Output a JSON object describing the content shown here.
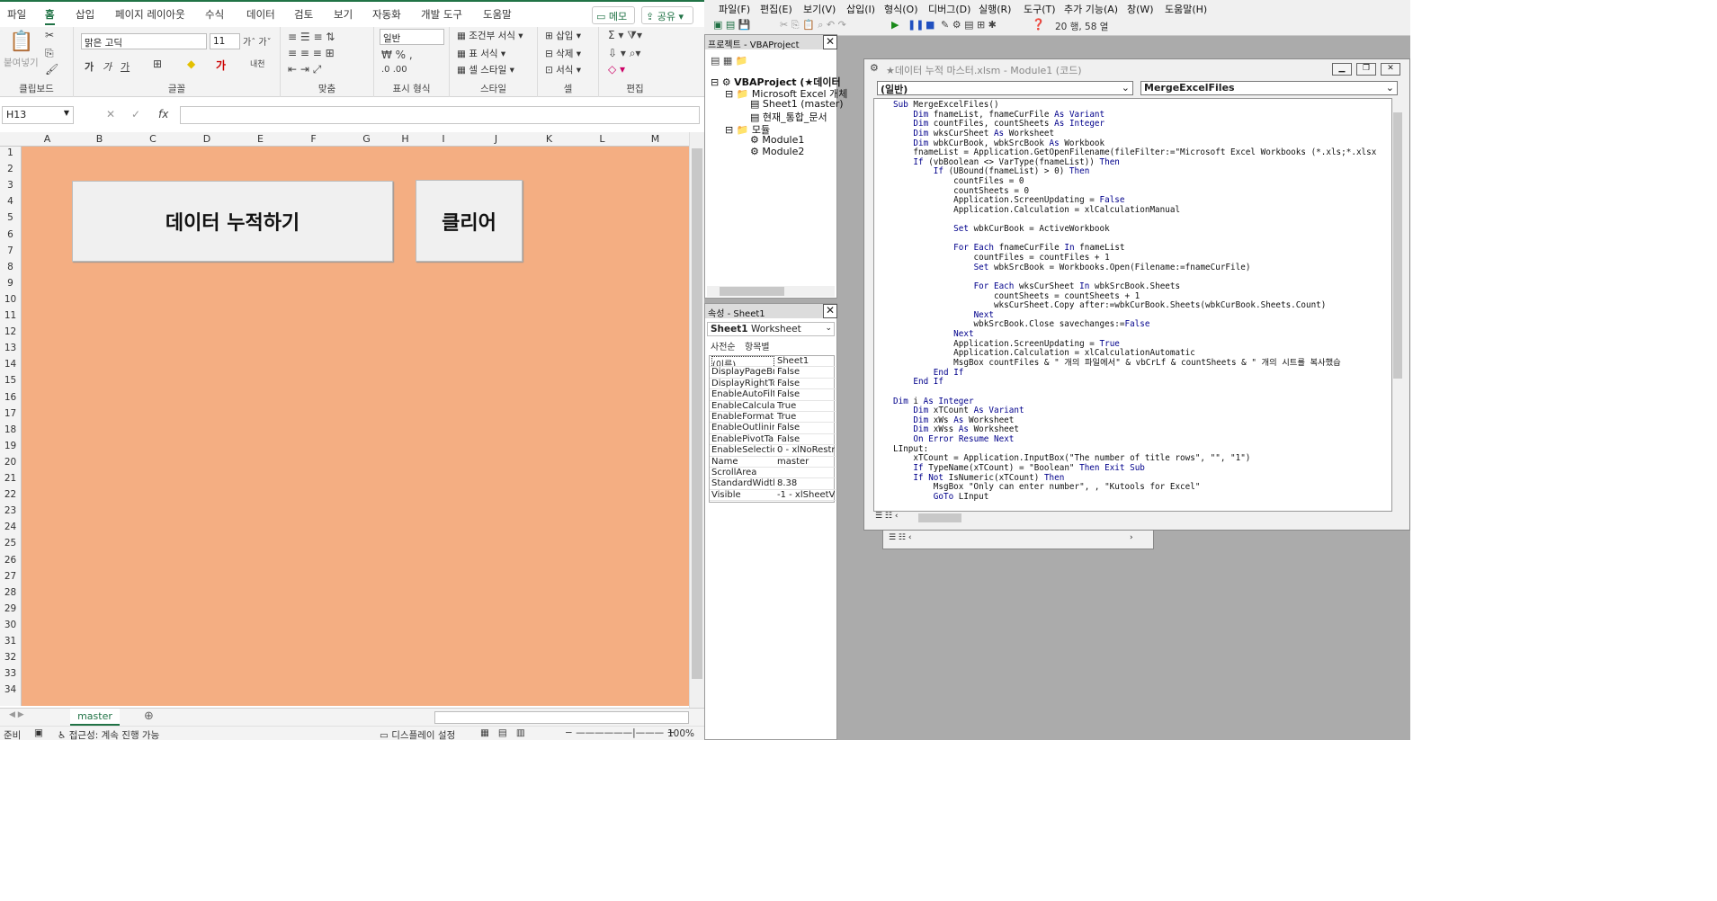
{
  "excel": {
    "tabs": [
      "파일",
      "홈",
      "삽입",
      "페이지 레이아웃",
      "수식",
      "데이터",
      "검토",
      "보기",
      "자동화",
      "개발 도구",
      "도움말"
    ],
    "memo": "메모",
    "share": "공유",
    "groups": [
      "클립보드",
      "글꼴",
      "맞춤",
      "표시 형식",
      "스타일",
      "셀",
      "편집"
    ],
    "paste_label": "붙여넣기",
    "font_name": "맑은 고딕",
    "font_size": "11",
    "number_format": "일반",
    "style_items": [
      "조건부 서식",
      "표 서식",
      "셀 스타일"
    ],
    "cell_items": [
      "삽입",
      "삭제",
      "서식"
    ],
    "name_box": "H13",
    "columns": [
      "A",
      "B",
      "C",
      "D",
      "E",
      "F",
      "G",
      "H",
      "I",
      "J",
      "K",
      "L",
      "M"
    ],
    "rows": [
      "1",
      "2",
      "3",
      "4",
      "5",
      "6",
      "7",
      "8",
      "9",
      "10",
      "11",
      "12",
      "13",
      "14",
      "15",
      "16",
      "17",
      "18",
      "19",
      "20",
      "21",
      "22",
      "23",
      "24",
      "25",
      "26",
      "27",
      "28",
      "29",
      "30",
      "31",
      "32",
      "33",
      "34"
    ],
    "button_accumulate": "데이터 누적하기",
    "button_clear": "클리어",
    "sheet_tab": "master",
    "status_ready": "준비",
    "status_access": "접근성: 계속 진행 가능",
    "status_display": "디스플레이 설정",
    "zoom": "100%",
    "colors": {
      "sheet_bg": "#f4ae82",
      "accent": "#217346"
    }
  },
  "vbe": {
    "menu": [
      "파일(F)",
      "편집(E)",
      "보기(V)",
      "삽입(I)",
      "형식(O)",
      "디버그(D)",
      "실행(R)",
      "도구(T)",
      "추가 기능(A)",
      "창(W)",
      "도움말(H)"
    ],
    "position": "20 행, 58 열",
    "project_title": "프로젝트 - VBAProject",
    "tree": [
      "VBAProject (★데이터",
      "Microsoft Excel 개체",
      "Sheet1 (master)",
      "현재_통합_문서",
      "모듈",
      "Module1",
      "Module2"
    ],
    "props_title": "속성 - Sheet1",
    "props_object": "Sheet1",
    "props_object_type": "Worksheet",
    "props_tabs": [
      "사전순",
      "항목별"
    ],
    "props": [
      [
        "(이름)",
        "Sheet1"
      ],
      [
        "DisplayPageBr",
        "False"
      ],
      [
        "DisplayRightTo",
        "False"
      ],
      [
        "EnableAutoFilte",
        "False"
      ],
      [
        "EnableCalculat",
        "True"
      ],
      [
        "EnableFormatC",
        "True"
      ],
      [
        "EnableOutlining",
        "False"
      ],
      [
        "EnablePivotTab",
        "False"
      ],
      [
        "EnableSelectio",
        "0 - xlNoRestri"
      ],
      [
        "Name",
        "master"
      ],
      [
        "ScrollArea",
        ""
      ],
      [
        "StandardWidth",
        "8.38"
      ],
      [
        "Visible",
        "-1 - xlSheetV"
      ]
    ],
    "code_title": "★데이터 누적 마스터.xlsm - Module1 (코드)",
    "combo_left": "(일반)",
    "combo_right": "MergeExcelFiles",
    "code": [
      "Sub MergeExcelFiles()",
      "    Dim fnameList, fnameCurFile As Variant",
      "    Dim countFiles, countSheets As Integer",
      "    Dim wksCurSheet As Worksheet",
      "    Dim wbkCurBook, wbkSrcBook As Workbook",
      "    fnameList = Application.GetOpenFilename(fileFilter:=\"Microsoft Excel Workbooks (*.xls;*.xlsx",
      "    If (vbBoolean <> VarType(fnameList)) Then",
      "        If (UBound(fnameList) > 0) Then",
      "            countFiles = 0",
      "            countSheets = 0",
      "            Application.ScreenUpdating = False",
      "            Application.Calculation = xlCalculationManual",
      "",
      "            Set wbkCurBook = ActiveWorkbook",
      "",
      "            For Each fnameCurFile In fnameList",
      "                countFiles = countFiles + 1",
      "                Set wbkSrcBook = Workbooks.Open(Filename:=fnameCurFile)",
      "",
      "                For Each wksCurSheet In wbkSrcBook.Sheets",
      "                    countSheets = countSheets + 1",
      "                    wksCurSheet.Copy after:=wbkCurBook.Sheets(wbkCurBook.Sheets.Count)",
      "                Next",
      "                wbkSrcBook.Close savechanges:=False",
      "            Next",
      "            Application.ScreenUpdating = True",
      "            Application.Calculation = xlCalculationAutomatic",
      "            MsgBox countFiles & \" 개의 파일에서\" & vbCrLf & countSheets & \" 개의 시트를 복사했습",
      "        End If",
      "    End If",
      "",
      "Dim i As Integer",
      "    Dim xTCount As Variant",
      "    Dim xWs As Worksheet",
      "    Dim xWss As Worksheet",
      "    On Error Resume Next",
      "LInput:",
      "    xTCount = Application.InputBox(\"The number of title rows\", \"\", \"1\")",
      "    If TypeName(xTCount) = \"Boolean\" Then Exit Sub",
      "    If Not IsNumeric(xTCount) Then",
      "        MsgBox \"Only can enter number\", , \"Kutools for Excel\"",
      "        GoTo LInput"
    ]
  }
}
